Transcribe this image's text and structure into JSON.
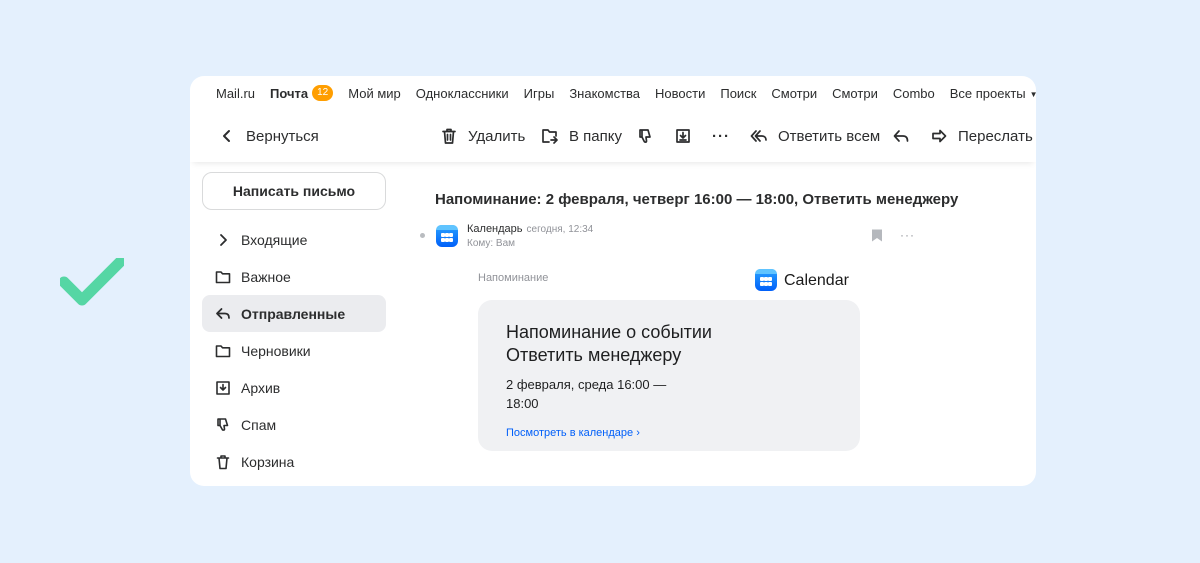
{
  "portal_nav": {
    "items": [
      "Mail.ru",
      "Почта",
      "Мой мир",
      "Одноклассники",
      "Игры",
      "Знакомства",
      "Новости",
      "Поиск",
      "Смотри",
      "Смотри",
      "Combo",
      "Все проекты"
    ],
    "mail_badge": "12"
  },
  "toolbar": {
    "back": "Вернуться",
    "delete": "Удалить",
    "to_folder": "В папку",
    "more": "···",
    "reply_all": "Ответить всем",
    "forward": "Переслать"
  },
  "sidebar": {
    "compose": "Написать письмо",
    "folders": [
      "Входящие",
      "Важное",
      "Отправленные",
      "Черновики",
      "Архив",
      "Спам",
      "Корзина"
    ],
    "active": "Отправленные"
  },
  "message": {
    "subject": "Напоминание: 2 февраля, четверг 16:00 — 18:00, Ответить менеджеру",
    "sender": "Календарь",
    "time": "сегодня, 12:34",
    "to": "Кому: Вам",
    "more": "···"
  },
  "reminder": {
    "label": "Напоминание",
    "brand": "Calendar",
    "title_line1": "Напоминание о событии",
    "title_line2": "Ответить менеджеру",
    "date_line1": "2 февраля, среда 16:00 —",
    "date_line2": "18:00",
    "link": "Посмотреть в календаре ›"
  },
  "colors": {
    "background": "#e4f0fd",
    "badge": "#ff9e00",
    "link": "#005ff9",
    "check": "#3fd39a"
  }
}
